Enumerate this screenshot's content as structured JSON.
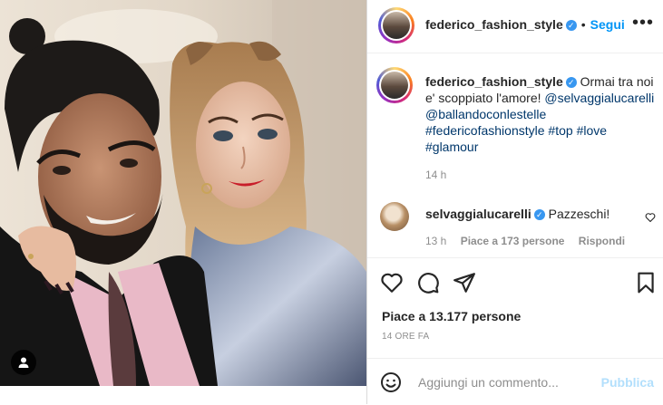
{
  "post": {
    "username": "federico_fashion_style",
    "follow_label": "Segui",
    "dot": "•",
    "more_label": "•••",
    "caption": {
      "username": "federico_fashion_style",
      "text": "Ormai tra noi e' scoppiato l'amore!",
      "mention1": "@selvaggialucarelli",
      "mention2": "@ballandoconlestelle",
      "tag1": "#federicofashionstyle",
      "tag2": "#top",
      "tag3": "#love",
      "tag4": "#glamour"
    },
    "caption_time": "14 h"
  },
  "comment": {
    "username": "selvaggialucarelli",
    "text": "Pazzeschi!",
    "time": "13 h",
    "likes": "Piace a 173 persone",
    "reply": "Rispondi"
  },
  "likes_text": "Piace a 13.177 persone",
  "time_ago": "14 ORE FA",
  "comment_bar": {
    "placeholder": "Aggiungi un commento...",
    "publish_label": "Pubblica"
  },
  "verified_mark": "✓",
  "colors": {
    "accent": "#0095f6",
    "verified": "#3897f0",
    "muted": "#8e8e8e",
    "publish_disabled": "#b2dffc"
  }
}
